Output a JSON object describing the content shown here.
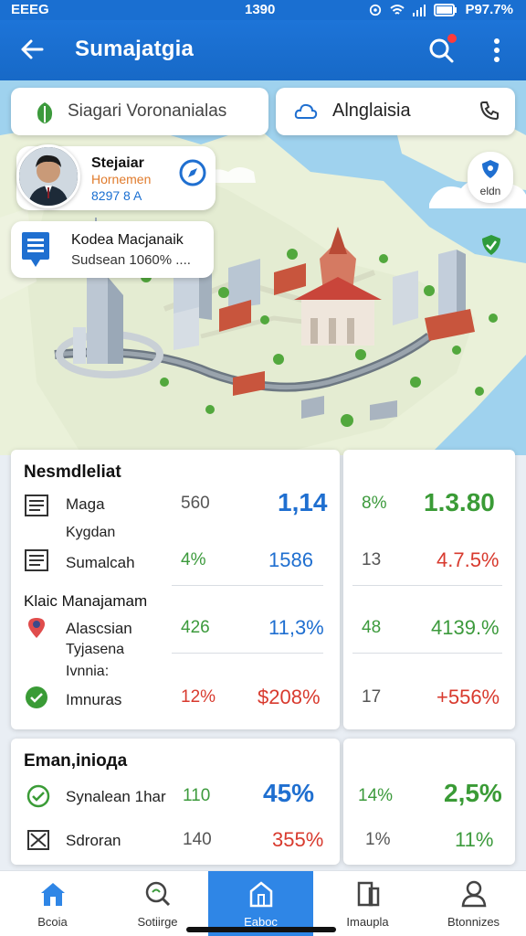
{
  "status_bar": {
    "left": "EEEG",
    "time": "1390",
    "battery": "P97.7%"
  },
  "app_bar": {
    "title": "Sumajatgia"
  },
  "search_chip": {
    "text": "Siagari Voronanialas"
  },
  "location_chip": {
    "text": "Alnglaisia"
  },
  "profile_card": {
    "name": "Stejaiar",
    "role": "Hornemen",
    "code": "8297 8 A"
  },
  "notice_card": {
    "title": "Kodea Macjanaik",
    "subtitle": "Sudsean 1060% ...."
  },
  "right_pin": {
    "label": "eldn"
  },
  "stats_top": {
    "section1_title": "Nesmdleliat",
    "section2_title": "Klaic Manajamam",
    "rows": [
      {
        "label": "Maga",
        "sublabel": "Kygdan",
        "v1": "560",
        "v2": "1,14",
        "v3": "8%",
        "v4": "1.3.80"
      },
      {
        "label": "Sumalcah",
        "v1": "4%",
        "v2": "1586",
        "v3": "13",
        "v4": "4.7.5%"
      },
      {
        "label": "Alascsian",
        "sublabel": "Tyjasena",
        "v1": "426",
        "v2": "11,3%",
        "v3": "48",
        "v4": "4139.%"
      },
      {
        "label": "Imnuras",
        "prelabel": "Ivnnia:",
        "v1": "12%",
        "v2": "$208%",
        "v3": "17",
        "v4": "+556%"
      }
    ]
  },
  "stats_bottom": {
    "title": "Eman,iniода",
    "rows": [
      {
        "label": "Synalean 1har",
        "v1": "110",
        "v2": "45%",
        "v3": "14%",
        "v4": "2,5%"
      },
      {
        "label": "Sdroran",
        "v1": "140",
        "v2": "355%",
        "v3": "1%",
        "v4": "11%"
      }
    ]
  },
  "bottom_nav": {
    "items": [
      {
        "label": "Bcoia",
        "icon": "home-icon"
      },
      {
        "label": "Sotiirge",
        "icon": "search-icon"
      },
      {
        "label": "Eaboc",
        "icon": "building-icon"
      },
      {
        "label": "Imaupla",
        "icon": "document-icon"
      },
      {
        "label": "Btonnizes",
        "icon": "person-icon"
      }
    ]
  },
  "colors": {
    "primary": "#1a6fd1",
    "green": "#3c9a3c",
    "red": "#d83a2e"
  }
}
